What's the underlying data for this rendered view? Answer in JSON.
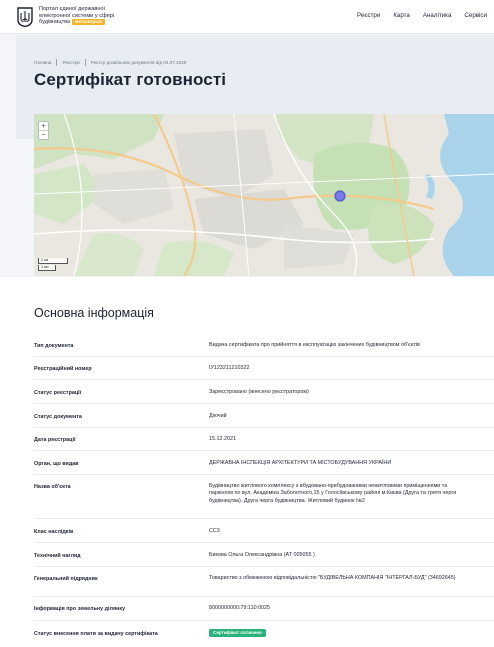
{
  "header": {
    "portal_line1": "Портал єдиної державної",
    "portal_line2": "електронної системи у сфері",
    "portal_line3": "будівництва",
    "beta_label": "Бета-версія",
    "nav": [
      "Реєстри",
      "Карта",
      "Аналітика",
      "Сервіси"
    ]
  },
  "breadcrumb": [
    "Головна",
    "Реєстри",
    "Реєстр дозвільних документів від 04.07.2020"
  ],
  "page_title": "Сертифікат готовності",
  "map": {
    "zoom_in": "+",
    "zoom_out": "−",
    "scale_km": "2 км",
    "scale_mi": "1 ми"
  },
  "section_title": "Основна інформація",
  "rows": [
    {
      "label": "Тип документа",
      "value": "Видача сертифіката про прийняття в експлуатацію закінчених будівництвом об'єктів"
    },
    {
      "label": "Реєстраційний номер",
      "value": "ІУ123211210322"
    },
    {
      "label": "Статус реєстрації",
      "value": "Зареєстровано (внесено реєстратором)"
    },
    {
      "label": "Статус документа",
      "value": "Діючий"
    },
    {
      "label": "Дата реєстрації",
      "value": "15.12.2021"
    },
    {
      "label": "Орган, що видав",
      "value": "ДЕРЖАВНА ІНСПЕКЦІЯ АРХІТЕКТУРИ ТА МІСТОБУДУВАННЯ УКРАЇНИ"
    },
    {
      "label": "Назва об'єкта",
      "value": "Будівництво житлового комплексу з вбудовано-прибудованими нежитловими приміщеннями та паркінгом по вул. Академіка Заболотного,15 у Голосіївському районі м.Києва (Друга та третя черги будівництва). Друга черга будівництва. Житловий будинок №2"
    },
    {
      "label": "Клас наслідків",
      "value": "СС3"
    },
    {
      "label": "Технічний нагляд",
      "value": "Бикова Ольга Олександрівна (АТ 005055 )"
    },
    {
      "label": "Генеральний підрядник",
      "value": "Товариство з обмеженою відповідальністю \"БУДІВЕЛЬНА КОМПАНІЯ \"ІНТЕРГАЛ-БУД\" (34692645)"
    },
    {
      "label": "Інформація про земельну ділянку",
      "value": "8000000000:79:110:0025"
    },
    {
      "label": "Статус внесення плати за видачу сертифіката",
      "value": "Сертифікат сплачено"
    }
  ],
  "colors": {
    "accent_badge": "#f4b52c",
    "paid_badge": "#2ab27b",
    "map_marker": "#6d6ff2"
  }
}
